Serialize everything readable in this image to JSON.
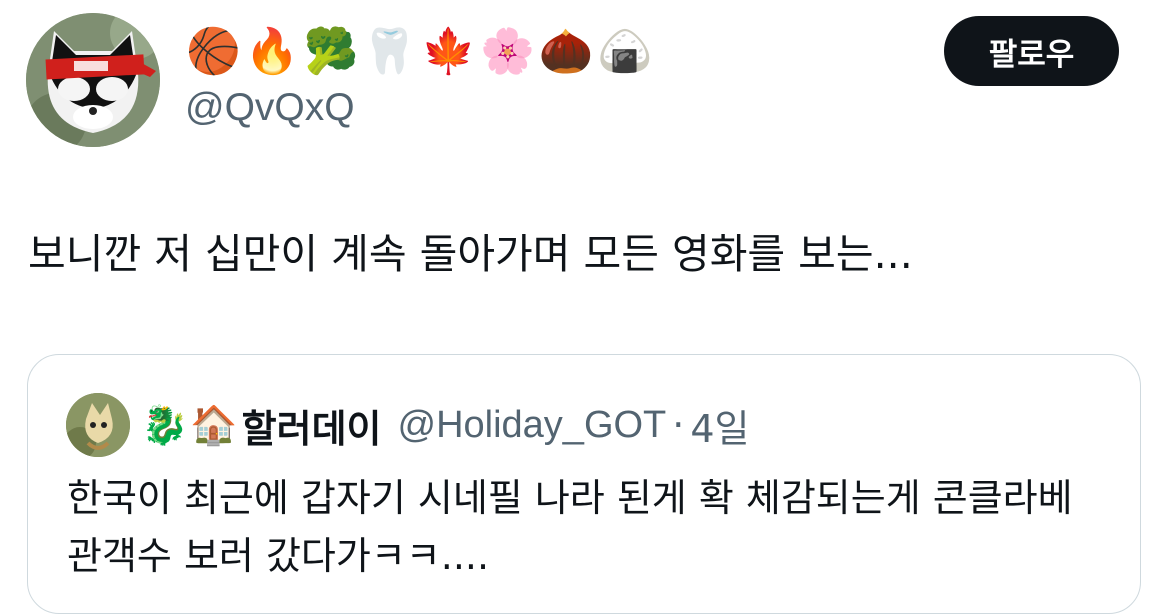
{
  "author": {
    "emoji_name": [
      "🏀",
      "🔥",
      "🥦",
      "🦷",
      "🍁",
      "🌸",
      "🌰",
      "🍙"
    ],
    "handle": "@QvQxQ",
    "avatar_icon": "masked-cat-avatar"
  },
  "follow_button": {
    "label": "팔로우"
  },
  "tweet": {
    "text": "보니깐 저 십만이 계속 돌아가며 모든 영화를 보는..."
  },
  "quoted_tweet": {
    "emoji": [
      "🐉",
      "🏠"
    ],
    "display_name": "할러데이",
    "handle": "@Holiday_GOT",
    "separator": "·",
    "time": "4일",
    "text": "한국이 최근에 갑자기 시네필 나라 된게 확 체감되는게 콘클라베 관객수 보러 갔다가ㅋㅋ...."
  },
  "colors": {
    "text_primary": "#0f1419",
    "text_secondary": "#536471",
    "border": "#cfd9de",
    "button_bg": "#0f1419"
  }
}
